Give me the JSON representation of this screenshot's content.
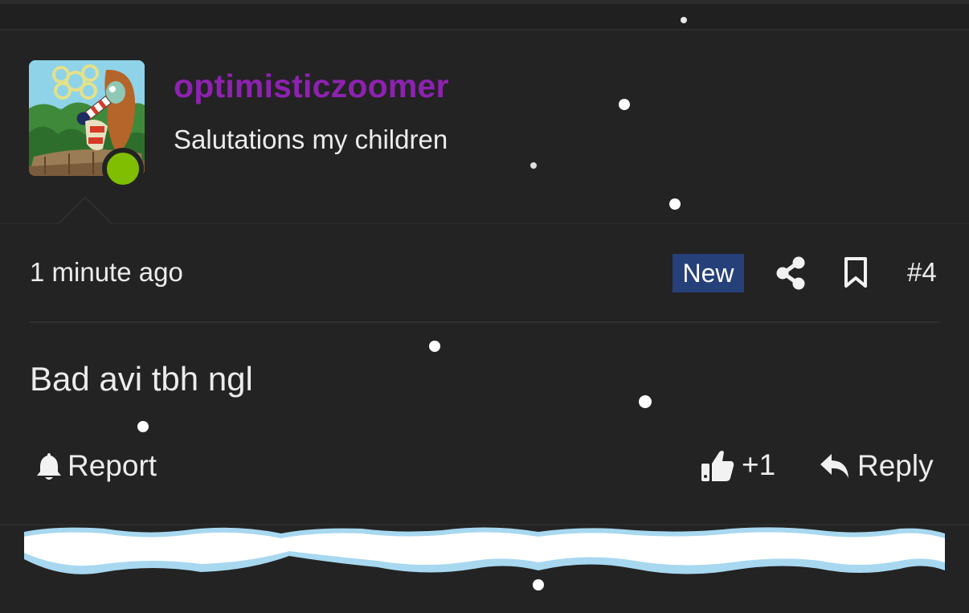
{
  "author": {
    "username": "optimisticzoomer",
    "user_title": "Salutations my children",
    "status": "online",
    "username_color": "#8e22b0",
    "online_color": "#7fbe00",
    "avatar_icon": "spongebob-squidward-avatar"
  },
  "post": {
    "time": "1 minute ago",
    "badge": "New",
    "badge_color": "#26407a",
    "number": "#4",
    "body": "Bad avi tbh ngl",
    "share_icon": "share-icon",
    "bookmark_icon": "bookmark-icon"
  },
  "actions": {
    "report_label": "Report",
    "like_count": "+1",
    "reply_label": "Reply"
  },
  "decor": {
    "snowbank_color": "#ffffff",
    "snowbank_edge_color": "#a8d8f0"
  }
}
